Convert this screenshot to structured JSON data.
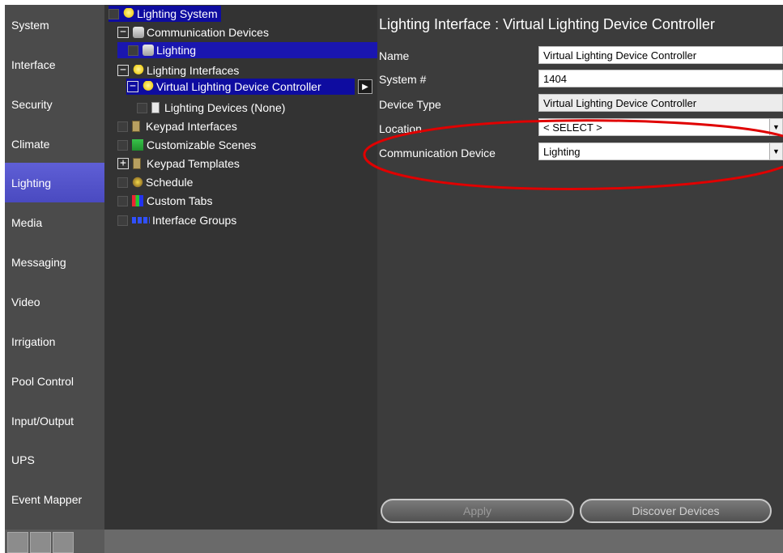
{
  "nav": {
    "items": [
      "System",
      "Interface",
      "Security",
      "Climate",
      "Lighting",
      "Media",
      "Messaging",
      "Video",
      "Irrigation",
      "Pool Control",
      "Input/Output",
      "UPS",
      "Event Mapper"
    ],
    "active": "Lighting"
  },
  "tree": {
    "root": "Lighting System",
    "comm_devices": "Communication Devices",
    "comm_lighting": "Lighting",
    "lighting_interfaces": "Lighting Interfaces",
    "vldc": "Virtual Lighting Device Controller",
    "lighting_devices": "Lighting Devices (None)",
    "keypad_interfaces": "Keypad Interfaces",
    "custom_scenes": "Customizable Scenes",
    "keypad_templates": "Keypad Templates",
    "schedule": "Schedule",
    "custom_tabs": "Custom Tabs",
    "interface_groups": "Interface Groups",
    "collapse_glyph": "−",
    "expand_glyph": "+",
    "arrow_glyph": "▶"
  },
  "panel": {
    "title": "Lighting Interface : Virtual Lighting Device Controller",
    "name_label": "Name",
    "name_value": "Virtual Lighting Device Controller",
    "system_label": "System #",
    "system_value": "1404",
    "type_label": "Device Type",
    "type_value": "Virtual Lighting Device Controller",
    "location_label": "Location",
    "location_value": "< SELECT >",
    "comm_label": "Communication Device",
    "comm_value": "Lighting",
    "dropdown_glyph": "▼",
    "apply_label": "Apply",
    "discover_label": "Discover Devices"
  },
  "colors": {
    "nav_bg": "#4b4b4b",
    "nav_active": "#5050c8",
    "tree_bg": "#333333",
    "tree_selected": "#1a16b0",
    "panel_bg": "#3c3c3c",
    "highlight_ellipse": "#e00000"
  }
}
